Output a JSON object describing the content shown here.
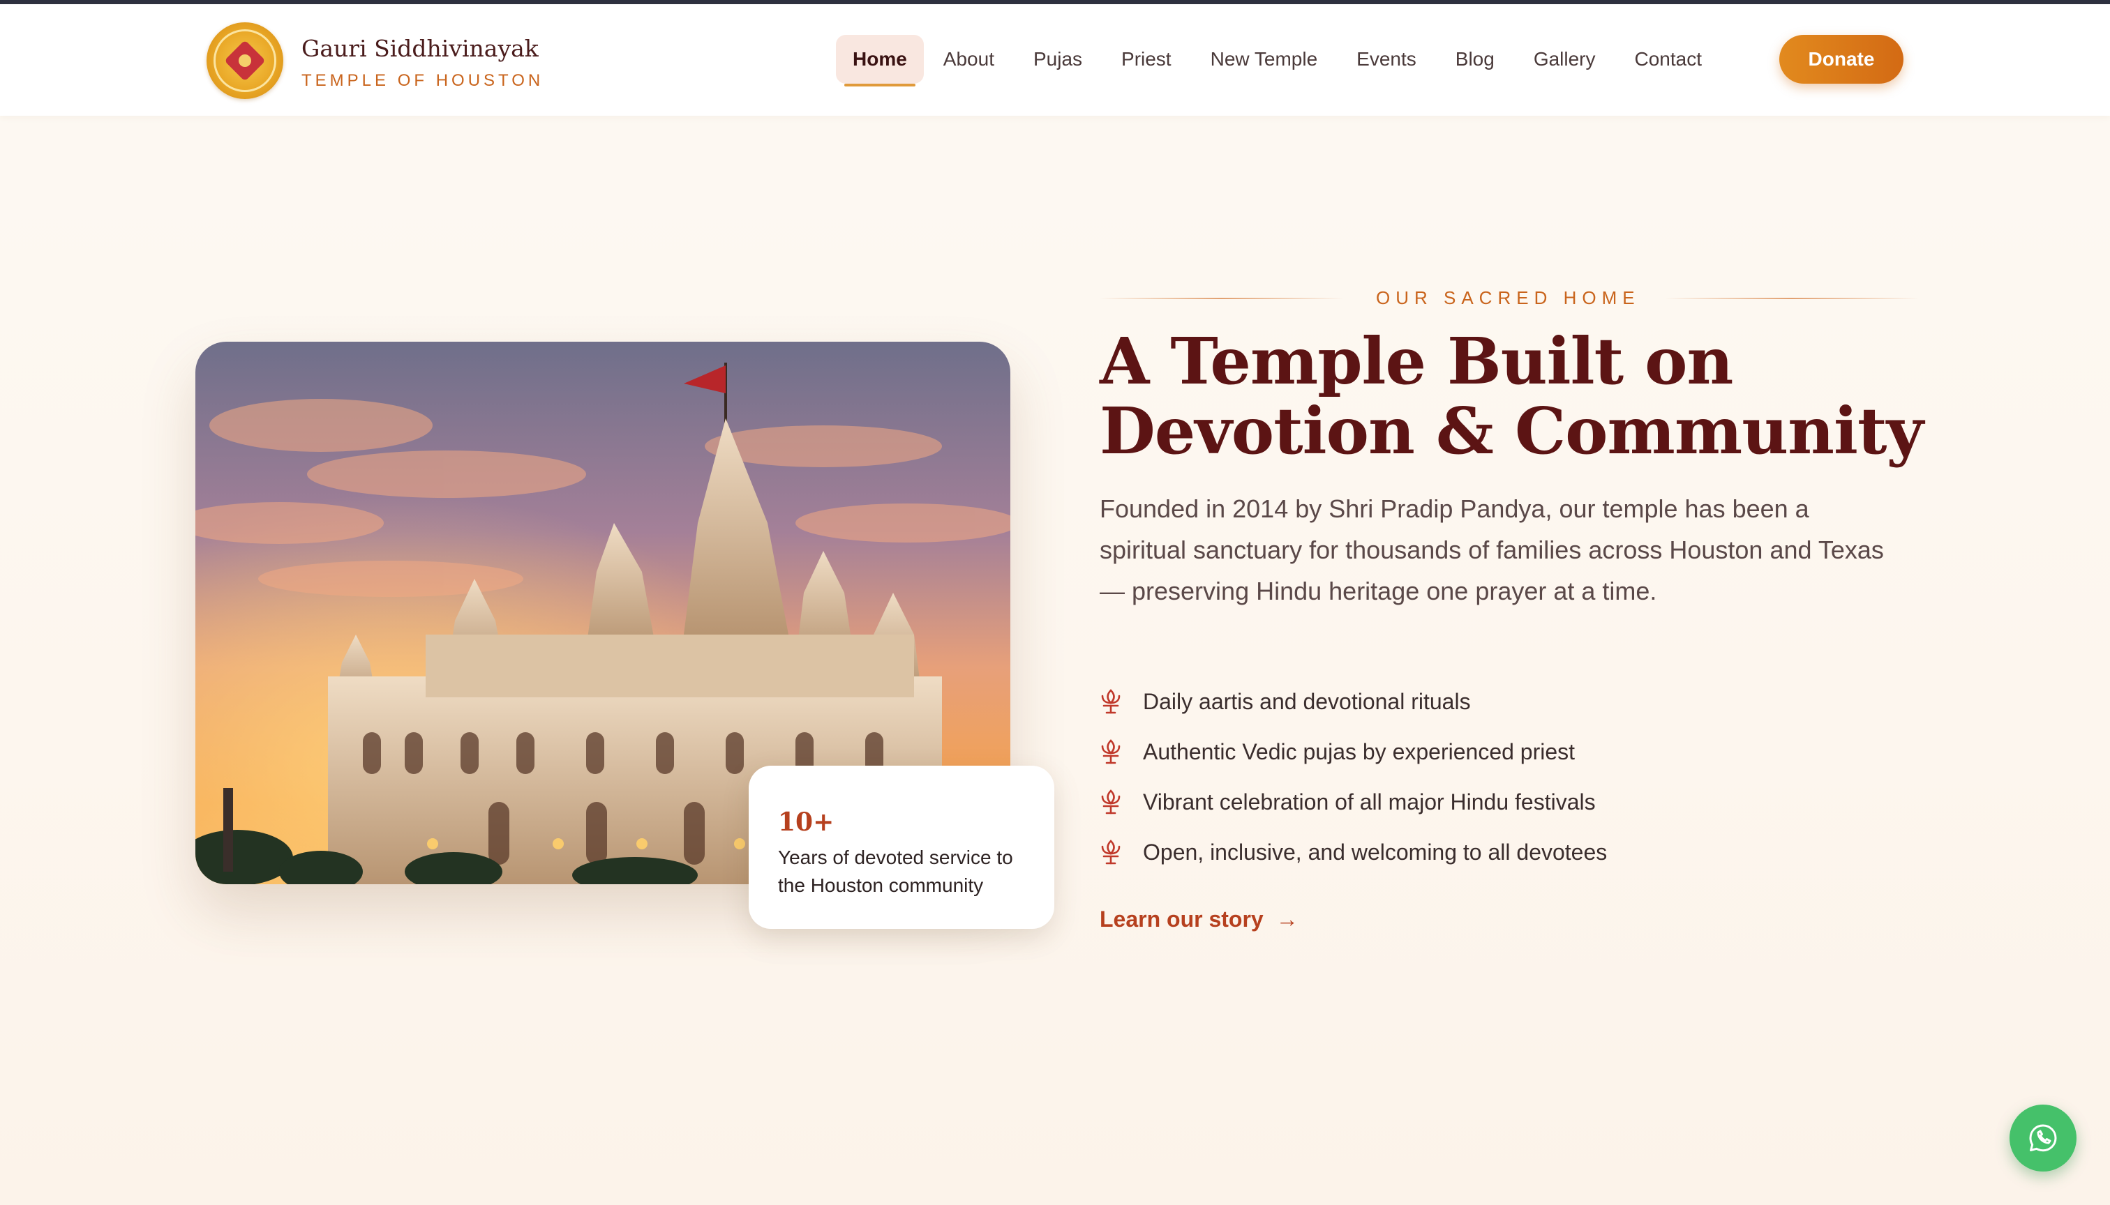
{
  "brand": {
    "name": "Gauri Siddhivinayak",
    "subtitle": "TEMPLE OF HOUSTON",
    "logo_icon": "temple-seal-icon"
  },
  "nav": {
    "items": [
      {
        "label": "Home",
        "active": true
      },
      {
        "label": "About"
      },
      {
        "label": "Pujas"
      },
      {
        "label": "Priest"
      },
      {
        "label": "New Temple"
      },
      {
        "label": "Events"
      },
      {
        "label": "Blog"
      },
      {
        "label": "Gallery"
      },
      {
        "label": "Contact"
      }
    ],
    "donate_label": "Donate"
  },
  "hero": {
    "eyebrow": "OUR SACRED HOME",
    "headline": "A Temple Built on Devotion & Community",
    "lead": "Founded in 2014 by Shri Pradip Pandya, our temple has been a spiritual sanctuary for thousands of families across Houston and Texas — preserving Hindu heritage one prayer at a time.",
    "features": [
      "Daily aartis and devotional rituals",
      "Authentic Vedic pujas by experienced priest",
      "Vibrant celebration of all major Hindu festivals",
      "Open, inclusive, and welcoming to all devotees"
    ],
    "feature_icon": "lotus-icon",
    "cta_label": "Learn our story",
    "cta_icon": "arrow-right-icon"
  },
  "stat": {
    "number": "10+",
    "text": "Years of devoted service to the Houston community"
  },
  "photo": {
    "subject": "temple-at-sunset-image"
  },
  "floating": {
    "whatsapp_icon": "whatsapp-icon"
  },
  "colors": {
    "brand_maroon": "#5c1414",
    "accent_orange": "#c9641c",
    "donate_start": "#e28a1e",
    "donate_end": "#d36a14",
    "whatsapp_green": "#45c16a"
  }
}
